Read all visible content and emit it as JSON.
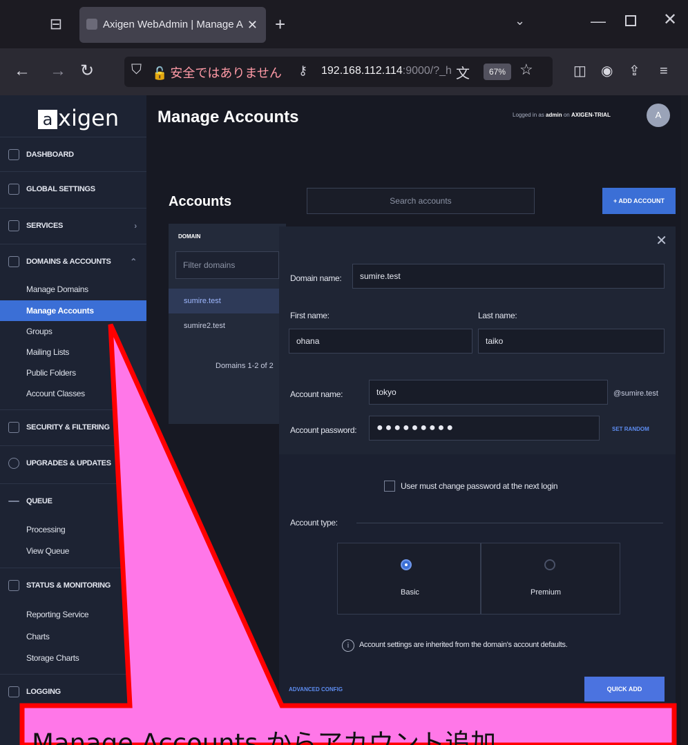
{
  "browser": {
    "tab_title": "Axigen WebAdmin | Manage A",
    "insecure_label": "安全ではありません",
    "url_main": "192.168.112.114",
    "url_rest": ":9000/?_h",
    "zoom": "67%"
  },
  "app": {
    "logo": "xigen",
    "logo_mark": "a",
    "page_title": "Manage Accounts",
    "logged_prefix": "Logged in as ",
    "logged_user": "admin",
    "logged_mid": " on ",
    "logged_server": "AXIGEN-TRIAL",
    "avatar_initial": "A"
  },
  "sidebar": {
    "dashboard": "DASHBOARD",
    "global_settings": "GLOBAL SETTINGS",
    "services": "SERVICES",
    "domains_accounts": "DOMAINS & ACCOUNTS",
    "manage_domains": "Manage Domains",
    "manage_accounts": "Manage Accounts",
    "groups": "Groups",
    "mailing_lists": "Mailing Lists",
    "public_folders": "Public Folders",
    "account_classes": "Account Classes",
    "security": "SECURITY & FILTERING",
    "upgrades": "UPGRADES & UPDATES",
    "queue": "QUEUE",
    "processing": "Processing",
    "view_queue": "View Queue",
    "status": "STATUS & MONITORING",
    "reporting": "Reporting Service",
    "charts": "Charts",
    "storage_charts": "Storage Charts",
    "logging": "LOGGING"
  },
  "accounts": {
    "title": "Accounts",
    "search_placeholder": "Search accounts",
    "add_button": "+ ADD ACCOUNT"
  },
  "domains": {
    "header": "DOMAIN",
    "filter_placeholder": "Filter domains",
    "items": [
      "sumire.test",
      "sumire2.test"
    ],
    "count": "Domains 1-2 of 2"
  },
  "form": {
    "domain_label": "Domain name:",
    "domain_value": "sumire.test",
    "first_label": "First name:",
    "first_value": "ohana",
    "last_label": "Last name:",
    "last_value": "taiko",
    "account_label": "Account name:",
    "account_value": "tokyo",
    "account_suffix": "@sumire.test",
    "password_label": "Account password:",
    "password_value": "●●●●●●●●●",
    "set_random": "SET RANDOM",
    "must_change": "User must change password at the next login",
    "type_label": "Account type:",
    "type_basic": "Basic",
    "type_premium": "Premium",
    "selected_type": "Basic",
    "inherit_note": "Account settings are inherited from the domain's account defaults.",
    "advanced": "ADVANCED CONFIG",
    "quick_add": "QUICK ADD"
  },
  "callout": {
    "text": "Manage Accounts からアカウント追加、",
    "fill": "#ff77e8",
    "stroke": "#ff0000"
  }
}
